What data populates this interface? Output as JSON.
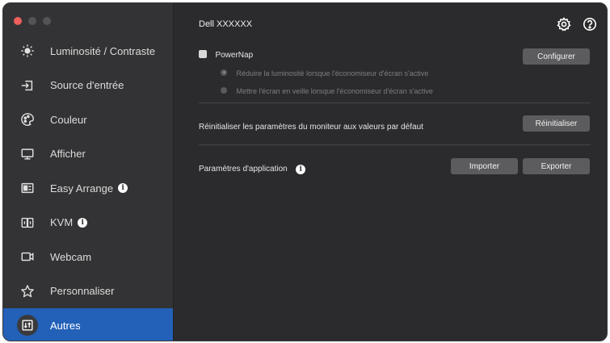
{
  "window": {
    "title": "Dell XXXXXX"
  },
  "sidebar": {
    "items": [
      {
        "label": "Luminosité / Contraste",
        "icon": "brightness-icon",
        "info": false,
        "active": false
      },
      {
        "label": "Source d'entrée",
        "icon": "input-source-icon",
        "info": false,
        "active": false
      },
      {
        "label": "Couleur",
        "icon": "color-icon",
        "info": false,
        "active": false
      },
      {
        "label": "Afficher",
        "icon": "display-icon",
        "info": false,
        "active": false
      },
      {
        "label": "Easy Arrange",
        "icon": "easy-arrange-icon",
        "info": true,
        "active": false
      },
      {
        "label": "KVM",
        "icon": "kvm-icon",
        "info": true,
        "active": false
      },
      {
        "label": "Webcam",
        "icon": "webcam-icon",
        "info": false,
        "active": false
      },
      {
        "label": "Personnaliser",
        "icon": "star-icon",
        "info": false,
        "active": false
      },
      {
        "label": "Autres",
        "icon": "others-icon",
        "info": false,
        "active": true
      }
    ]
  },
  "main": {
    "powernap": {
      "label": "PowerNap",
      "checked": false,
      "options": [
        {
          "label": "Réduire la luminosité lorsque l'économiseur d'écran s'active",
          "selected": true
        },
        {
          "label": "Mettre l'écran en veille lorsque l'économiseur d'écran s'active",
          "selected": false
        }
      ],
      "configure_label": "Configurer"
    },
    "reset": {
      "label": "Réinitialiser les paramètres du moniteur aux valeurs par défaut",
      "button_label": "Réinitialiser"
    },
    "app_settings": {
      "label": "Paramètres d'application",
      "import_label": "Importer",
      "export_label": "Exporter"
    }
  },
  "colors": {
    "accent": "#2361b8",
    "window_bg": "#2b2b2d",
    "sidebar_bg": "#333335",
    "button_bg": "#5c5c5e"
  }
}
